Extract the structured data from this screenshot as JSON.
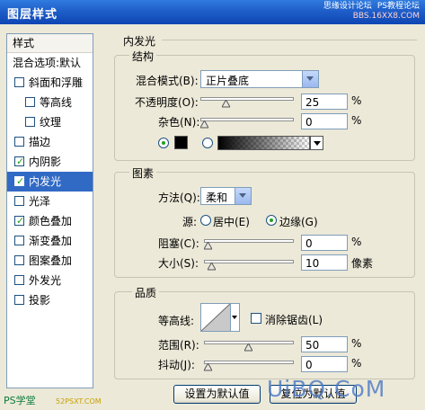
{
  "window": {
    "title": "图层样式",
    "watermark_top_line1": "思缘设计论坛",
    "watermark_top_line2": "PS教程论坛",
    "watermark_top_line3": "BBS.16XX8.COM"
  },
  "sidebar": {
    "header": "样式",
    "items": [
      {
        "label": "混合选项:默认",
        "checkbox": false,
        "checked": false,
        "indent": false,
        "selected": false
      },
      {
        "label": "斜面和浮雕",
        "checkbox": true,
        "checked": false,
        "indent": false,
        "selected": false
      },
      {
        "label": "等高线",
        "checkbox": true,
        "checked": false,
        "indent": true,
        "selected": false
      },
      {
        "label": "纹理",
        "checkbox": true,
        "checked": false,
        "indent": true,
        "selected": false
      },
      {
        "label": "描边",
        "checkbox": true,
        "checked": false,
        "indent": false,
        "selected": false
      },
      {
        "label": "内阴影",
        "checkbox": true,
        "checked": true,
        "indent": false,
        "selected": false
      },
      {
        "label": "内发光",
        "checkbox": true,
        "checked": true,
        "indent": false,
        "selected": true
      },
      {
        "label": "光泽",
        "checkbox": true,
        "checked": false,
        "indent": false,
        "selected": false
      },
      {
        "label": "颜色叠加",
        "checkbox": true,
        "checked": true,
        "indent": false,
        "selected": false
      },
      {
        "label": "渐变叠加",
        "checkbox": true,
        "checked": false,
        "indent": false,
        "selected": false
      },
      {
        "label": "图案叠加",
        "checkbox": true,
        "checked": false,
        "indent": false,
        "selected": false
      },
      {
        "label": "外发光",
        "checkbox": true,
        "checked": false,
        "indent": false,
        "selected": false
      },
      {
        "label": "投影",
        "checkbox": true,
        "checked": false,
        "indent": false,
        "selected": false
      }
    ]
  },
  "panel": {
    "title": "内发光",
    "structure": {
      "title": "结构",
      "blend_mode_label": "混合模式(B):",
      "blend_mode_value": "正片叠底",
      "opacity_label": "不透明度(O):",
      "opacity_value": "25",
      "opacity_unit": "%",
      "opacity_fraction": 0.25,
      "noise_label": "杂色(N):",
      "noise_value": "0",
      "noise_unit": "%",
      "noise_fraction": 0.0,
      "color_swatch": "#000000",
      "color_radio_selected": "solid"
    },
    "elements": {
      "title": "图素",
      "technique_label": "方法(Q):",
      "technique_value": "柔和",
      "source_label": "源:",
      "source_center": "居中(E)",
      "source_edge": "边缘(G)",
      "source_selected": "edge",
      "choke_label": "阻塞(C):",
      "choke_value": "0",
      "choke_unit": "%",
      "choke_fraction": 0.0,
      "size_label": "大小(S):",
      "size_value": "10",
      "size_unit": "像素",
      "size_fraction": 0.04
    },
    "quality": {
      "title": "品质",
      "contour_label": "等高线:",
      "antialias_label": "消除锯齿(L)",
      "antialias_checked": false,
      "range_label": "范围(R):",
      "range_value": "50",
      "range_unit": "%",
      "range_fraction": 0.5,
      "jitter_label": "抖动(J):",
      "jitter_value": "0",
      "jitter_unit": "%",
      "jitter_fraction": 0.0
    },
    "buttons": {
      "set_default": "设置为默认值",
      "reset_default": "复位为默认值"
    }
  },
  "watermarks": {
    "bottom_left": "PS学堂",
    "bottom_left_url": "52PSXT.COM",
    "bottom_right": "UiBQ.CoM"
  }
}
